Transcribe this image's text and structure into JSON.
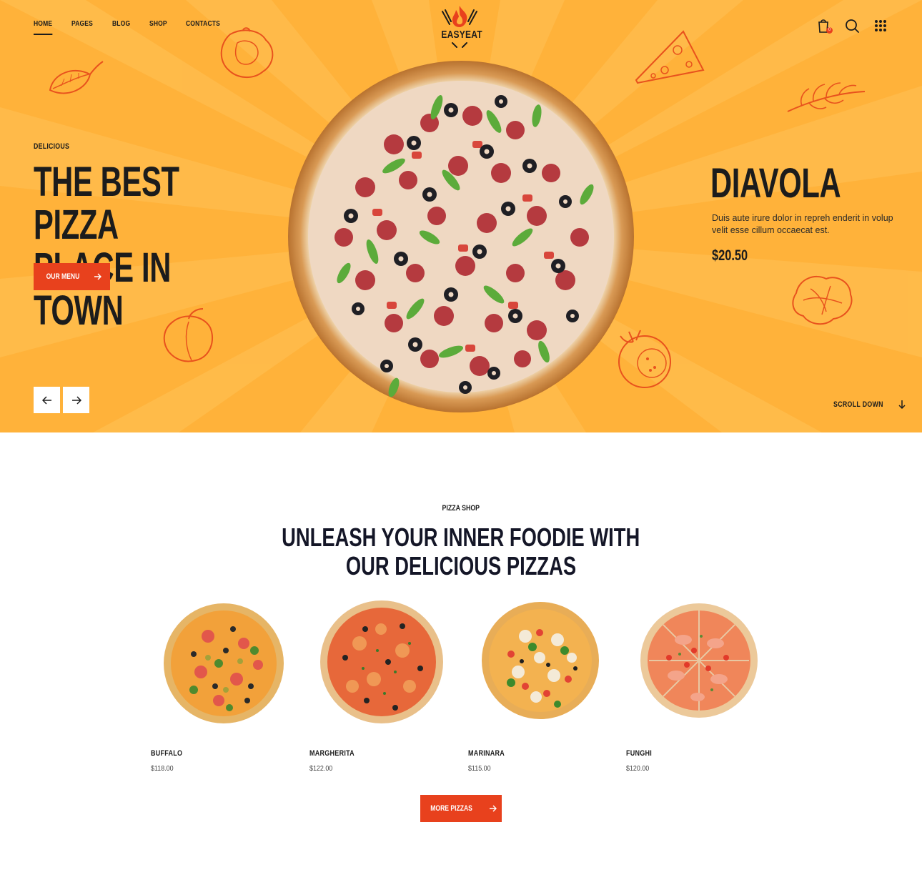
{
  "nav": {
    "items": [
      {
        "label": "HOME",
        "active": true
      },
      {
        "label": "PAGES",
        "active": false
      },
      {
        "label": "BLOG",
        "active": false
      },
      {
        "label": "SHOP",
        "active": false
      },
      {
        "label": "CONTACTS",
        "active": false
      }
    ]
  },
  "logo": {
    "text": "EASYEAT"
  },
  "header_icons": {
    "cart_count": "0",
    "icons": [
      "shopping-bag-icon",
      "search-icon",
      "grid-menu-icon"
    ]
  },
  "hero": {
    "eyebrow": "DELICIOUS",
    "title_line1": "THE BEST PIZZA",
    "title_line2": "PLACE IN TOWN",
    "button_label": "OUR MENU",
    "product_name": "DIAVOLA",
    "product_description": "Duis aute irure dolor in repreh enderit in volup velit esse cillum occaecat est.",
    "product_price": "$20.50",
    "scroll_label": "SCROLL DOWN",
    "background_color": "#ffb23a"
  },
  "shop": {
    "eyebrow": "PIZZA SHOP",
    "title_line1": "UNLEASH YOUR INNER FOODIE WITH",
    "title_line2": "OUR DELICIOUS PIZZAS",
    "products": [
      {
        "name": "BUFFALO",
        "price": "$118.00"
      },
      {
        "name": "MARGHERITA",
        "price": "$122.00"
      },
      {
        "name": "MARINARA",
        "price": "$115.00"
      },
      {
        "name": "FUNGHI",
        "price": "$120.00"
      }
    ],
    "more_button_label": "MORE PIZZAS"
  },
  "colors": {
    "accent": "#e8411d",
    "dark": "#1c1c1c"
  }
}
